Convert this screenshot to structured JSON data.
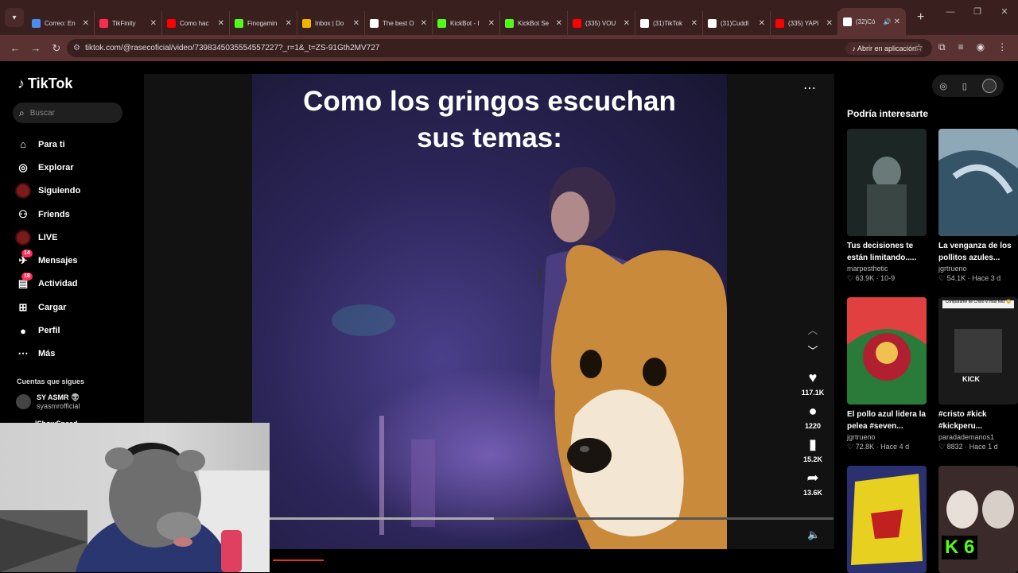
{
  "browser": {
    "tabs": [
      {
        "title": "Correo: En",
        "color": "#4a8cf0"
      },
      {
        "title": "TikFinity",
        "color": "#fe2c55"
      },
      {
        "title": "Como hac",
        "color": "#ff0000"
      },
      {
        "title": "Finogamin",
        "color": "#53fc18"
      },
      {
        "title": "Inbox | Do",
        "color": "#f0b400"
      },
      {
        "title": "The best O",
        "color": "#ffffff"
      },
      {
        "title": "KickBot - I",
        "color": "#53fc18"
      },
      {
        "title": "KickBot Se",
        "color": "#53fc18"
      },
      {
        "title": "(335) VOU",
        "color": "#ff0000"
      },
      {
        "title": "(31)TikTok",
        "color": "#ffffff"
      },
      {
        "title": "(31)Cuddl",
        "color": "#ffffff"
      },
      {
        "title": "(335) YAPI",
        "color": "#ff0000"
      },
      {
        "title": "(32)Có",
        "color": "#ffffff"
      }
    ],
    "url": "tiktok.com/@rasecoficial/video/7398345035554557227?_r=1&_t=ZS-91Gth2MV727",
    "open_in_app": "Abrir en aplicación"
  },
  "sidebar": {
    "logo": "TikTok",
    "search_placeholder": "Buscar",
    "menu": [
      {
        "label": "Para ti",
        "icon": "home-icon"
      },
      {
        "label": "Explorar",
        "icon": "compass-icon"
      },
      {
        "label": "Siguiendo",
        "icon": "following-avatar-icon"
      },
      {
        "label": "Friends",
        "icon": "friends-icon"
      },
      {
        "label": "LIVE",
        "icon": "live-avatar-icon"
      },
      {
        "label": "Mensajes",
        "icon": "messages-icon",
        "badge": "14"
      },
      {
        "label": "Actividad",
        "icon": "activity-icon",
        "badge": "18"
      },
      {
        "label": "Cargar",
        "icon": "upload-icon"
      },
      {
        "label": "Perfil",
        "icon": "profile-icon"
      },
      {
        "label": "Más",
        "icon": "more-icon"
      }
    ],
    "following_title": "Cuentas que sigues",
    "following": [
      {
        "name": "SY ASMR 👽",
        "handle": "syasmrofficial"
      },
      {
        "name": "IShowSpeed"
      }
    ]
  },
  "video": {
    "caption_line1": "Como los gringos escuchan",
    "caption_line2": "sus temas:",
    "progress_fraction": 0.4,
    "actions": [
      {
        "icon": "heart-icon",
        "count": "117.1K"
      },
      {
        "icon": "comment-icon",
        "count": "1220"
      },
      {
        "icon": "bookmark-icon",
        "count": "15.2K"
      },
      {
        "icon": "share-icon",
        "count": "13.6K"
      }
    ]
  },
  "recommendations": {
    "title": "Podría interesarte",
    "cards": [
      {
        "title": "Tus decisiones te están limitando.....",
        "user": "marpesthetic",
        "likes": "63.9K",
        "when": "10-9"
      },
      {
        "title": "La venganza de los pollitos azules...",
        "user": "jgrtrueno",
        "likes": "54.1K",
        "when": "Hace 3 d"
      },
      {
        "title": "El pollo azul lidera la pelea #seven...",
        "user": "jgrtrueno",
        "likes": "72.8K",
        "when": "Hace 4 d"
      },
      {
        "title": "#cristo #kick #kickperu...",
        "user": "paradademanos1",
        "likes": "8832",
        "when": "Hace 1 d"
      },
      {
        "title": "",
        "user": "",
        "likes": "",
        "when": ""
      },
      {
        "title": "",
        "user": "",
        "likes": "",
        "when": ""
      }
    ],
    "card2_overlay": "Comparame de Cristo vi más feliz 😊",
    "card2_logo": "KICK",
    "card5_overlay": "K 6"
  }
}
